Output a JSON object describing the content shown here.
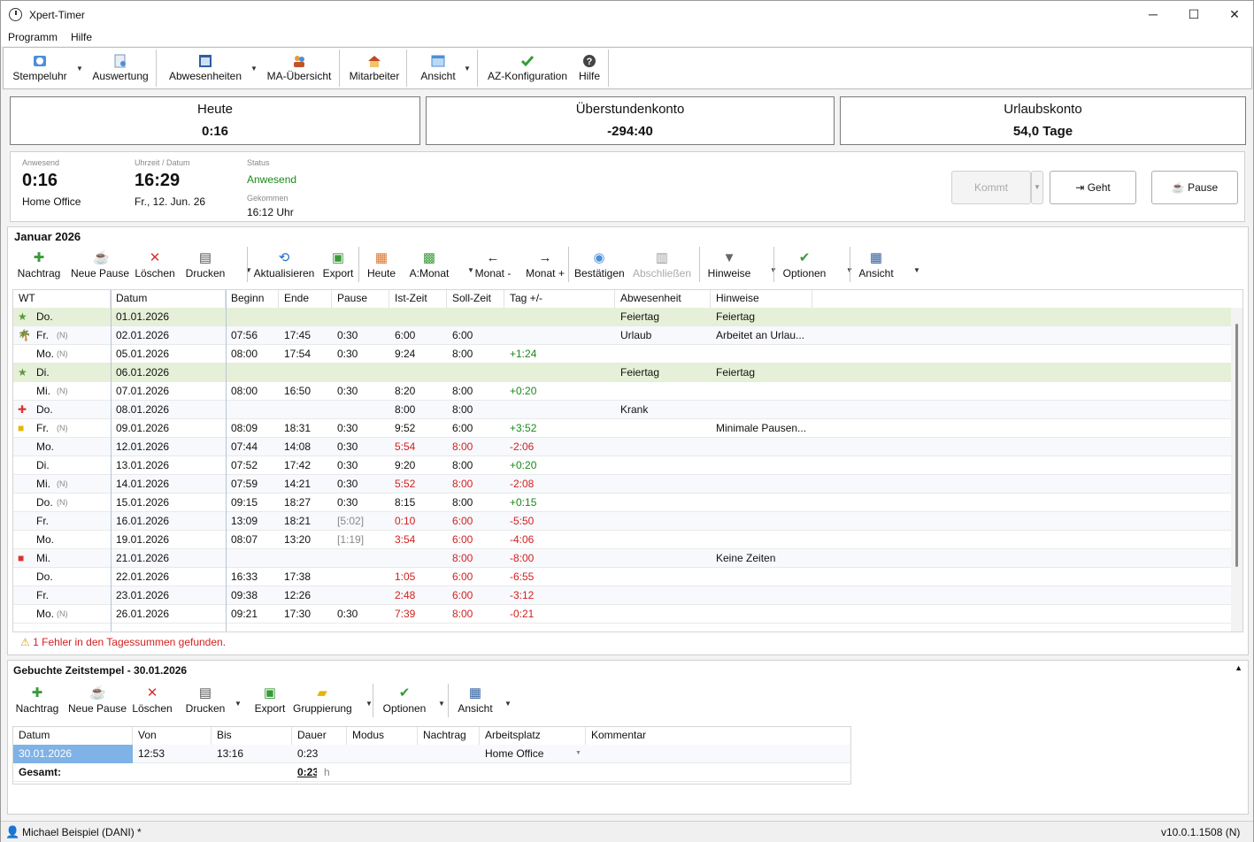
{
  "window": {
    "title": "Xpert-Timer",
    "minimize": "─",
    "maximize": "☐",
    "close": "✕"
  },
  "menu": [
    "Programm",
    "Hilfe"
  ],
  "toolbar": [
    "Stempeluhr",
    "Auswertung",
    "Abwesenheiten",
    "MA-Übersicht",
    "Mitarbeiter",
    "Ansicht",
    "AZ-Konfiguration",
    "Hilfe"
  ],
  "cards": [
    {
      "title": "Heute",
      "value": "0:16"
    },
    {
      "title": "Überstundenkonto",
      "value": "-294:40"
    },
    {
      "title": "Urlaubskonto",
      "value": "54,0 Tage"
    }
  ],
  "status": {
    "anwesend_label": "Anwesend",
    "anwesend_value": "0:16",
    "location": "Home Office",
    "time_label": "Uhrzeit / Datum",
    "time_value": "16:29",
    "date": "Fr., 12. Jun. 26",
    "status_label": "Status",
    "status_value": "Anwesend",
    "gekommen_label": "Gekommen",
    "gekommen_value": "16:12 Uhr",
    "kommt": "Kommt",
    "geht": "Geht",
    "pause": "Pause"
  },
  "month": {
    "title": "Januar 2026",
    "toolbar": [
      "Nachtrag",
      "Neue Pause",
      "Löschen",
      "Drucken",
      "Aktualisieren",
      "Export",
      "Heute",
      "A:Monat",
      "Monat -",
      "Monat +",
      "Bestätigen",
      "Abschließen",
      "Hinweise",
      "Optionen",
      "Ansicht"
    ],
    "headers": [
      "WT",
      "Datum",
      "Beginn",
      "Ende",
      "Pause",
      "Ist-Zeit",
      "Soll-Zeit",
      "Tag +/-",
      "Abwesenheit",
      "Hinweise"
    ],
    "rows": [
      [
        "Do.",
        "",
        "01.01.2026",
        "",
        "",
        "",
        "",
        "",
        "",
        "Feiertag",
        "Feiertag"
      ],
      [
        "Fr.",
        "(N)",
        "02.01.2026",
        "07:56",
        "17:45",
        "0:30",
        "6:00",
        "6:00",
        "",
        "Urlaub",
        "Arbeitet an Urlau..."
      ],
      [
        "Mo.",
        "(N)",
        "05.01.2026",
        "08:00",
        "17:54",
        "0:30",
        "9:24",
        "8:00",
        "+1:24",
        "",
        ""
      ],
      [
        "Di.",
        "",
        "06.01.2026",
        "",
        "",
        "",
        "",
        "",
        "",
        "Feiertag",
        "Feiertag"
      ],
      [
        "Mi.",
        "(N)",
        "07.01.2026",
        "08:00",
        "16:50",
        "0:30",
        "8:20",
        "8:00",
        "+0:20",
        "",
        ""
      ],
      [
        "Do.",
        "",
        "08.01.2026",
        "",
        "",
        "",
        "8:00",
        "8:00",
        "",
        "Krank",
        ""
      ],
      [
        "Fr.",
        "(N)",
        "09.01.2026",
        "08:09",
        "18:31",
        "0:30",
        "9:52",
        "6:00",
        "+3:52",
        "",
        "Minimale Pausen..."
      ],
      [
        "Mo.",
        "",
        "12.01.2026",
        "07:44",
        "14:08",
        "0:30",
        "5:54",
        "8:00",
        "-2:06",
        "",
        ""
      ],
      [
        "Di.",
        "",
        "13.01.2026",
        "07:52",
        "17:42",
        "0:30",
        "9:20",
        "8:00",
        "+0:20",
        "",
        ""
      ],
      [
        "Mi.",
        "(N)",
        "14.01.2026",
        "07:59",
        "14:21",
        "0:30",
        "5:52",
        "8:00",
        "-2:08",
        "",
        ""
      ],
      [
        "Do.",
        "(N)",
        "15.01.2026",
        "09:15",
        "18:27",
        "0:30",
        "8:15",
        "8:00",
        "+0:15",
        "",
        ""
      ],
      [
        "Fr.",
        "",
        "16.01.2026",
        "13:09",
        "18:21",
        "[5:02]",
        "0:10",
        "6:00",
        "-5:50",
        "",
        ""
      ],
      [
        "Mo.",
        "",
        "19.01.2026",
        "08:07",
        "13:20",
        "[1:19]",
        "3:54",
        "6:00",
        "-4:06",
        "",
        ""
      ],
      [
        "Mi.",
        "",
        "21.01.2026",
        "",
        "",
        "",
        "",
        "8:00",
        "-8:00",
        "",
        "Keine Zeiten"
      ],
      [
        "Do.",
        "",
        "22.01.2026",
        "16:33",
        "17:38",
        "",
        "1:05",
        "6:00",
        "-6:55",
        "",
        ""
      ],
      [
        "Fr.",
        "",
        "23.01.2026",
        "09:38",
        "12:26",
        "",
        "2:48",
        "6:00",
        "-3:12",
        "",
        ""
      ],
      [
        "Mo.",
        "(N)",
        "26.01.2026",
        "09:21",
        "17:30",
        "0:30",
        "7:39",
        "8:00",
        "-0:21",
        "",
        ""
      ]
    ],
    "error": "1 Fehler in den Tagessummen gefunden."
  },
  "stamps": {
    "title": "Gebuchte Zeitstempel - 30.01.2026",
    "toolbar": [
      "Nachtrag",
      "Neue Pause",
      "Löschen",
      "Drucken",
      "Export",
      "Gruppierung",
      "Optionen",
      "Ansicht"
    ],
    "headers": [
      "Datum",
      "Von",
      "Bis",
      "Dauer",
      "Modus",
      "Nachtrag",
      "Arbeitsplatz",
      "Kommentar"
    ],
    "row": [
      "30.01.2026",
      "12:53",
      "13:16",
      "0:23",
      "",
      "",
      "Home Office",
      ""
    ],
    "total_label": "Gesamt:",
    "total_value": "0:23",
    "total_unit": "h"
  },
  "statusbar": {
    "user": "Michael Beispiel (DANI) *",
    "version": "v10.0.1.1508 (N)"
  }
}
